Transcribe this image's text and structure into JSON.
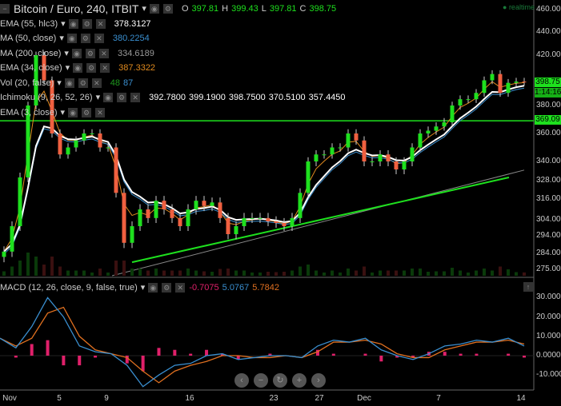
{
  "header": {
    "title": "Bitcoin / Euro, 240, ITBIT",
    "o_label": "O",
    "o": "397.81",
    "h_label": "H",
    "h": "399.43",
    "l_label": "L",
    "l": "397.81",
    "c_label": "C",
    "c": "398.75"
  },
  "indicators": [
    {
      "label": "EMA (55, hlc3)",
      "values": [
        "378.3127"
      ],
      "colors": [
        "#ffffff"
      ]
    },
    {
      "label": "MA (50, close)",
      "values": [
        "380.2254"
      ],
      "colors": [
        "#3a8fd0"
      ]
    },
    {
      "label": "MA (200, close)",
      "values": [
        "334.6189"
      ],
      "colors": [
        "#999999"
      ]
    },
    {
      "label": "EMA (34, close)",
      "values": [
        "387.3322"
      ],
      "colors": [
        "#e08a1e"
      ]
    },
    {
      "label": "Vol (20, false)",
      "values": [
        "48",
        "87"
      ],
      "colors": [
        "#1e9a1e",
        "#3a8fd0"
      ]
    },
    {
      "label": "Ichimoku (9, 26, 52, 26)",
      "values": [
        "392.7800",
        "399.1900",
        "398.7500",
        "370.5100",
        "357.4450"
      ],
      "colors": [
        "#ffffff",
        "#ffffff",
        "#ffffff",
        "#ffffff",
        "#ffffff"
      ]
    },
    {
      "label": "EMA (3, close)",
      "values": [],
      "colors": []
    }
  ],
  "realtime": "realtime",
  "price_tag": "398.75",
  "countdown": "1:14:16",
  "hline_tag": "369.09",
  "macd": {
    "label": "MACD (12, 26, close, 9, false, true)",
    "values": [
      "-0.7075",
      "5.0767",
      "5.7842"
    ],
    "colors": [
      "#e0206a",
      "#3a8fd0",
      "#e07020"
    ]
  },
  "nav": [
    "‹",
    "−",
    "↻",
    "+",
    "›"
  ],
  "chart_data": [
    {
      "type": "candlestick",
      "title": "Bitcoin / Euro, 240, ITBIT",
      "y_ticks": [
        "460.00",
        "440.00",
        "420.00",
        "380.00",
        "360.00",
        "340.00",
        "328.00",
        "316.00",
        "304.00",
        "294.00",
        "284.00",
        "275.00"
      ],
      "x_ticks": [
        "Nov",
        "5",
        "9",
        "16",
        "23",
        "27",
        "Dec",
        "7",
        "14"
      ],
      "close": [
        285,
        300,
        330,
        380,
        420,
        400,
        360,
        345,
        350,
        355,
        360,
        360,
        350,
        350,
        320,
        290,
        300,
        310,
        305,
        315,
        310,
        305,
        300,
        310,
        315,
        312,
        314,
        305,
        295,
        300,
        305,
        305,
        305,
        303,
        302,
        300,
        305,
        320,
        340,
        345,
        345,
        350,
        350,
        360,
        355,
        340,
        340,
        345,
        340,
        335,
        340,
        350,
        360,
        362,
        365,
        368,
        380,
        385,
        385,
        390,
        400,
        405,
        390,
        398,
        399,
        398.75
      ],
      "horizontal_line": 369.09,
      "trendline": [
        279,
        330
      ],
      "ma200_range": [
        275,
        334.6
      ]
    },
    {
      "type": "line",
      "title": "MACD (12, 26, close, 9, false, true)",
      "y_ticks": [
        "30.0000",
        "20.0000",
        "10.0000",
        "0.0000",
        "-10.0000"
      ],
      "macd": [
        9,
        4,
        15,
        30,
        20,
        5,
        2,
        1,
        -5,
        -16,
        -10,
        -5,
        -4,
        0,
        1,
        -2,
        -1,
        0,
        0,
        -1,
        5,
        8,
        7,
        9,
        3,
        0,
        -2,
        1,
        5,
        6,
        8,
        7,
        9,
        5
      ],
      "signal": [
        9,
        5,
        9,
        22,
        25,
        10,
        3,
        1,
        -1,
        -8,
        -14,
        -8,
        -5,
        -3,
        0,
        0,
        -1,
        -1,
        0,
        -1,
        2,
        7,
        7,
        8,
        6,
        1,
        -1,
        -1,
        3,
        5,
        7,
        7,
        8,
        6
      ]
    }
  ]
}
